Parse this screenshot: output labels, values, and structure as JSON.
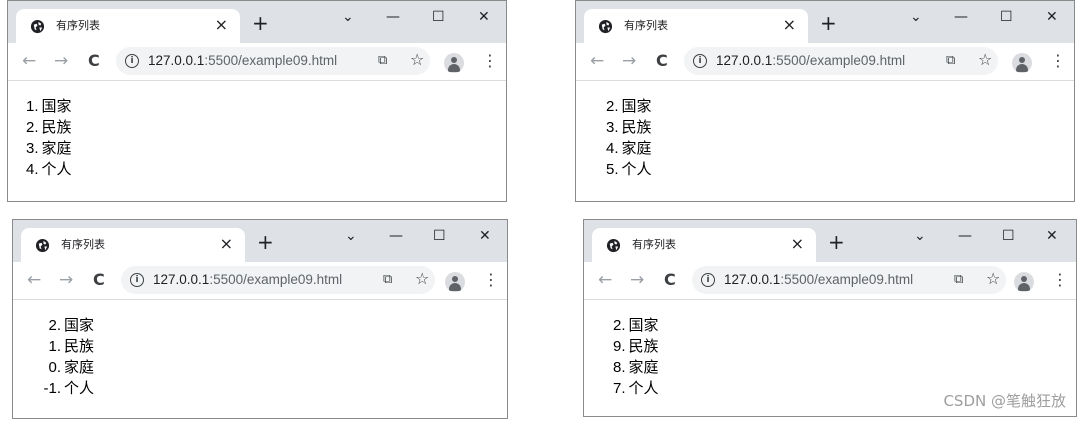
{
  "common": {
    "tab_title": "有序列表",
    "tab_close": "×",
    "new_tab": "+",
    "url_host": "127.0.0.1",
    "url_rest": ":5500/example09.html",
    "nav_back": "←",
    "nav_forward": "→",
    "nav_reload": "C",
    "info": "i",
    "share": "⧉",
    "star": "☆",
    "kebab": "⋮",
    "win_dropdown": "⌄",
    "win_minimize": "—",
    "win_maximize": "☐",
    "win_close": "✕"
  },
  "windows": [
    {
      "items": [
        {
          "num": "1.",
          "text": "国家"
        },
        {
          "num": "2.",
          "text": "民族"
        },
        {
          "num": "3.",
          "text": "家庭"
        },
        {
          "num": "4.",
          "text": "个人"
        }
      ]
    },
    {
      "items": [
        {
          "num": "2.",
          "text": "国家"
        },
        {
          "num": "3.",
          "text": "民族"
        },
        {
          "num": "4.",
          "text": "家庭"
        },
        {
          "num": "5.",
          "text": "个人"
        }
      ]
    },
    {
      "items": [
        {
          "num": "2.",
          "text": "国家"
        },
        {
          "num": "1.",
          "text": "民族"
        },
        {
          "num": "0.",
          "text": "家庭"
        },
        {
          "num": "-1.",
          "text": "个人"
        }
      ]
    },
    {
      "items": [
        {
          "num": "2.",
          "text": "国家"
        },
        {
          "num": "9.",
          "text": "民族"
        },
        {
          "num": "8.",
          "text": "家庭"
        },
        {
          "num": "7.",
          "text": "个人"
        }
      ]
    }
  ],
  "watermark": "CSDN @笔触狂放"
}
